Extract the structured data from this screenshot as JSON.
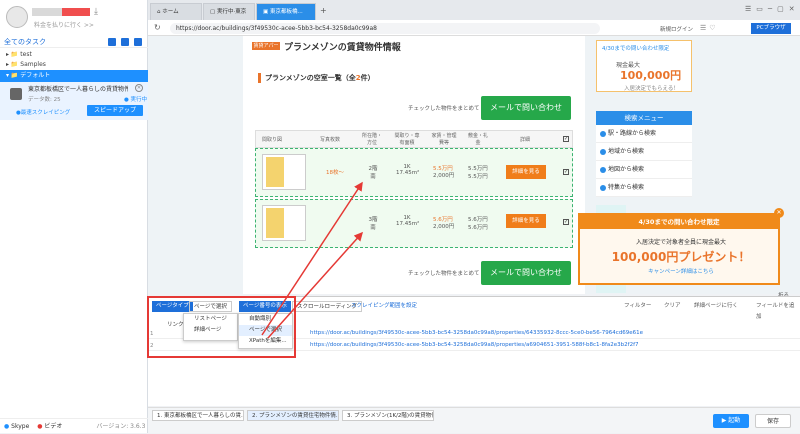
{
  "left": {
    "subtitle": "料金を払りに行く >>",
    "tasks_header": "全てのタスク",
    "folders": [
      "test",
      "Samples"
    ],
    "default_group": "デフォルト",
    "task": {
      "name": "東京都板橋区で一人暮らしの賃貸物件一覧...",
      "data": "データ数: 25",
      "status": "● 実行中",
      "link": "●最速スクレイピング",
      "speed": "スピードアップ"
    },
    "skype": "Skype",
    "video": "ビデオ",
    "version": "バージョン: 3.6.3"
  },
  "browser": {
    "tabs": [
      "ホーム",
      "実行中·東京",
      "東京都板橋..."
    ],
    "url": "https://door.ac/buildings/3f49530c-acee-5bb3-bc54-3258da0c99a8",
    "login": "新規ログイン",
    "pc_button": "PCブラウザ"
  },
  "page": {
    "badge": "賃貸アパート",
    "heading": "プランメゾンの賃貸物件情報",
    "list_title_pre": "プランメゾンの空室一覧（全",
    "list_count": "2",
    "list_title_post": "件）",
    "check_note": "チェックした物件をまとめて",
    "mail_btn": "メールで問い合わせ",
    "columns": [
      "間取り図",
      "写真枚数",
      "所在階・方位",
      "間取り・専有面積",
      "家賃・管理費等",
      "敷金・礼金",
      "詳細"
    ],
    "rows": [
      {
        "photos": "18枚〜",
        "floor": "2階\n南",
        "layout": "1K\n17.45m²",
        "rent": "5.5万円",
        "fee": "2,000円",
        "deposit": "5.5万円\n5.5万円",
        "detail": "詳細を見る"
      },
      {
        "photos": "",
        "floor": "3階\n南",
        "layout": "1K\n17.45m²",
        "rent": "5.6万円",
        "fee": "2,000円",
        "deposit": "5.6万円\n5.6万円",
        "detail": "詳細を見る"
      }
    ]
  },
  "right": {
    "promo_small_a": "4/30までの問い合わせ限定",
    "promo_small_b": "現金最大",
    "promo_small_amount": "100,000円",
    "promo_small_c": "入居決定でもらえる！",
    "menu_title": "検索メニュー",
    "menu_items": [
      "駅・路線から検索",
      "地域から検索",
      "地図から検索",
      "特集から検索"
    ],
    "promo_head": "4/30までの問い合わせ限定",
    "promo_line": "入居決定で対象者全員に現金最大",
    "promo_big": "100,000円プレゼント！",
    "promo_link": "キャンペーン詳細はこちら",
    "collapse": "折る"
  },
  "panel": {
    "page_type": "ページタイプ",
    "page_select": "ページで選択",
    "page_rule": "ページ番号の表示",
    "scroll": "スクロールローディング",
    "scrape_range": "スクレイピング範囲を設定",
    "filter": "フィルター",
    "clear": "クリア",
    "goto_detail": "詳細ページに行く",
    "add_field": "フィールドを追加",
    "menu1": [
      "リストページ",
      "詳細ページ"
    ],
    "menu2": [
      "自動識別",
      "ページで選択",
      "XPathを編集..."
    ],
    "link_label": "リンク1",
    "urls": [
      "https://door.ac/buildings/3f49530c-acee-5bb3-bc54-3258da0c99a8/properties/64335932-8ccc-5ce0-be56-7964cd69e61e",
      "https://door.ac/buildings/3f49530c-acee-5bb3-bc54-3258da0c99a8/properties/a6904651-3951-588f-b8c1-8fa2e3b2f2f7"
    ]
  },
  "footer": {
    "tabs": [
      "1. 東京都板橋区で一人暮らしの賃...",
      "2. プランメゾンの賃貸住宅物件情...",
      "3. プランメゾン(1K/2階)の賃貸物件..."
    ],
    "start": "▶ 起動",
    "save": "保存"
  }
}
